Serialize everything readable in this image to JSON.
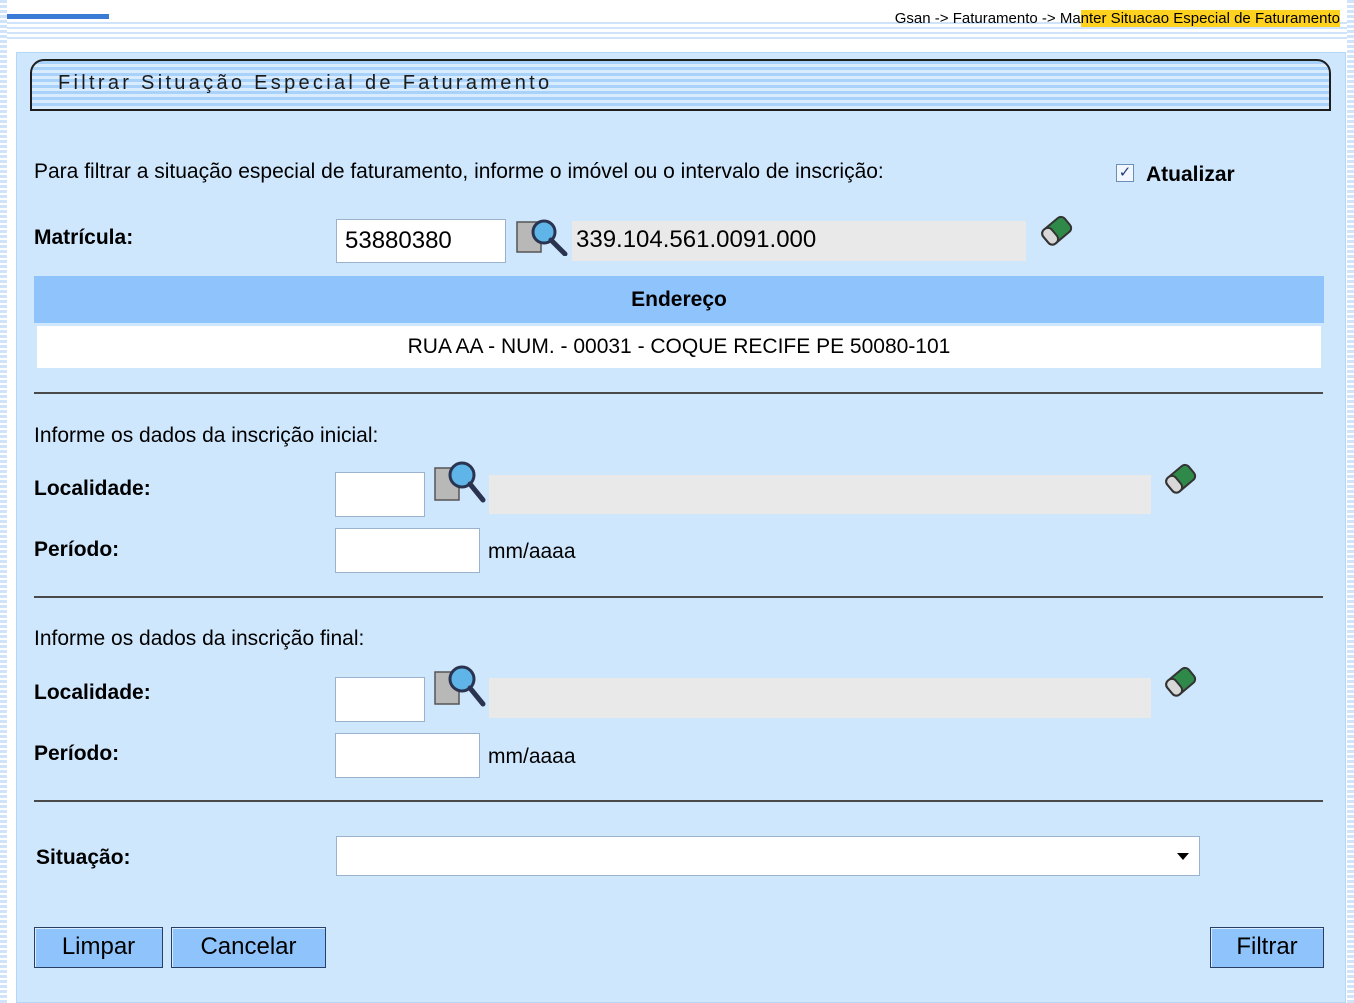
{
  "breadcrumb": {
    "prefix": "Gsan -> Faturamento -> Ma",
    "highlighted": "nter Situacao Especial de Faturamento"
  },
  "page": {
    "title": "Filtrar Situação Especial de Faturamento",
    "instructions": "Para filtrar a situação especial de faturamento, informe o imóvel ou o intervalo de inscrição:",
    "atualizar": {
      "label": "Atualizar",
      "checked": true
    }
  },
  "matricula": {
    "label": "Matrícula:",
    "value": "53880380",
    "inscricao": "339.104.561.0091.000"
  },
  "endereco": {
    "header": "Endereço",
    "value": "RUA AA - NUM. - 00031 - COQUE RECIFE PE 50080-101"
  },
  "inicial": {
    "heading": "Informe os dados da inscrição inicial:",
    "localidade_label": "Localidade:",
    "localidade_value": "",
    "localidade_desc": "",
    "periodo_label": "Período:",
    "periodo_value": "",
    "periodo_hint": "mm/aaaa"
  },
  "final": {
    "heading": "Informe os dados da inscrição final:",
    "localidade_label": "Localidade:",
    "localidade_value": "",
    "localidade_desc": "",
    "periodo_label": "Período:",
    "periodo_value": "",
    "periodo_hint": "mm/aaaa"
  },
  "situacao": {
    "label": "Situação:",
    "selected": ""
  },
  "buttons": {
    "limpar": "Limpar",
    "cancelar": "Cancelar",
    "filtrar": "Filtrar"
  },
  "icons": {
    "search": "search-magnifier-icon",
    "eraser": "eraser-icon",
    "check": "checkmark"
  },
  "colors": {
    "panel_bg": "#cfe7fd",
    "header_blue": "#8ec4fb",
    "highlight_yellow": "#ffd21f"
  }
}
